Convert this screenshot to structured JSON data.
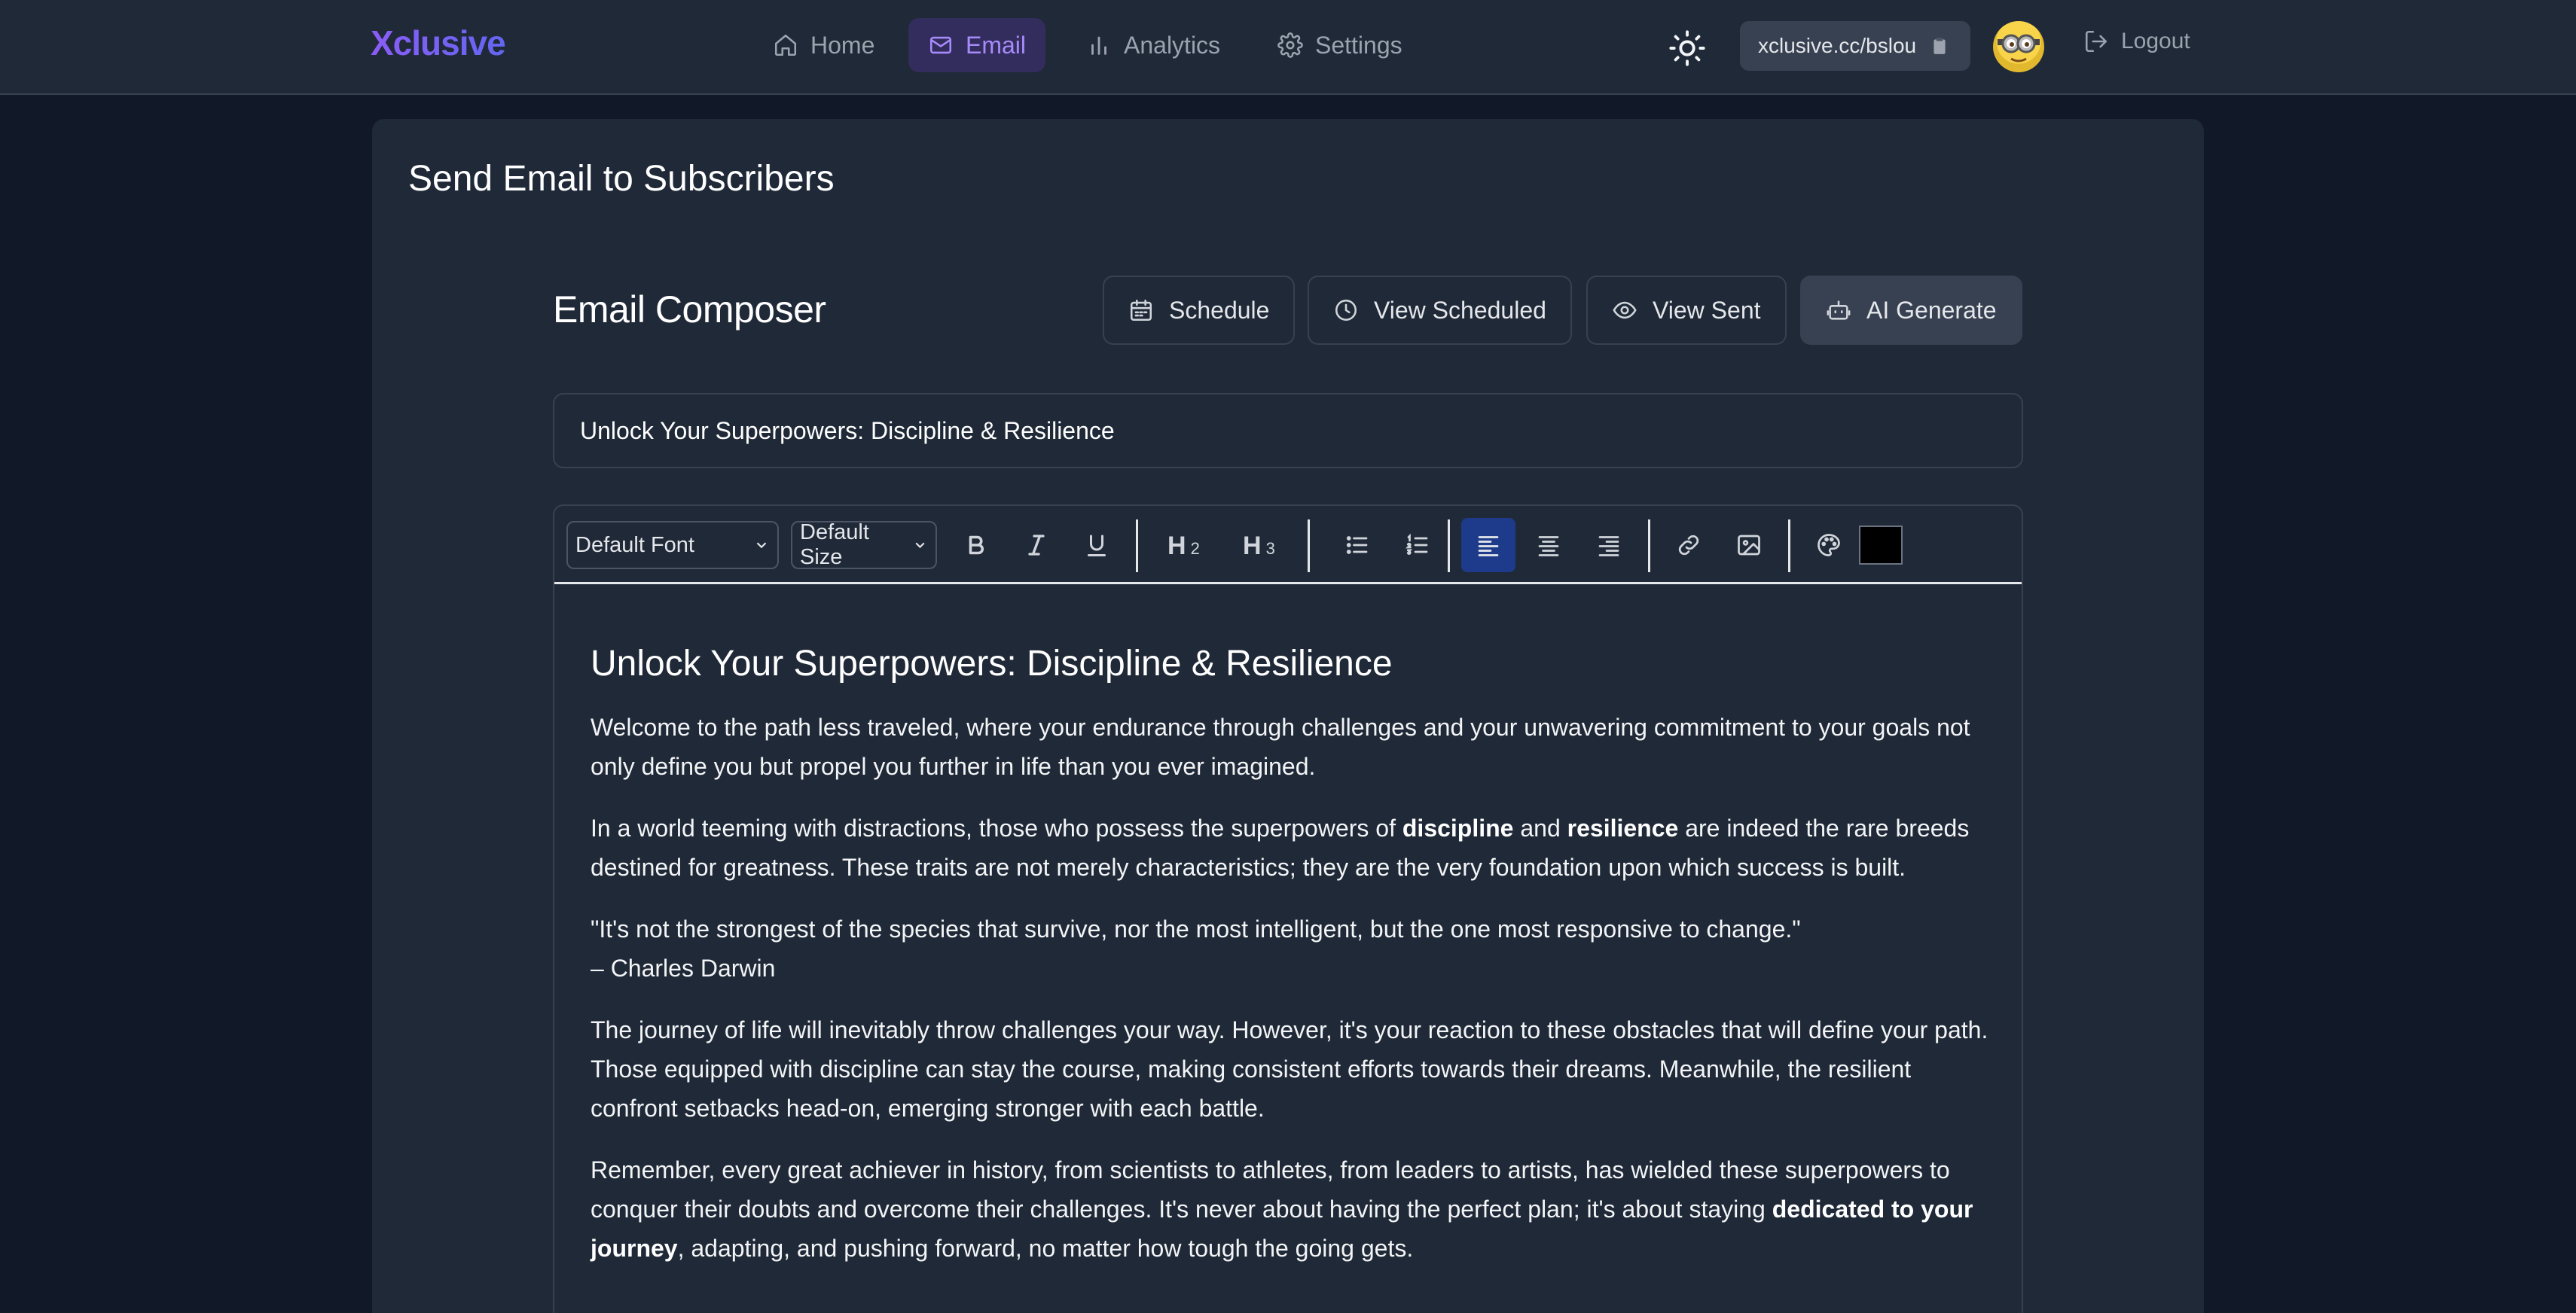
{
  "brand": "Xclusive",
  "nav": {
    "home": "Home",
    "email": "Email",
    "analytics": "Analytics",
    "settings": "Settings"
  },
  "header": {
    "url": "xclusive.cc/bslou",
    "logout": "Logout"
  },
  "page": {
    "title": "Send Email to Subscribers"
  },
  "composer": {
    "title": "Email Composer",
    "buttons": {
      "schedule": "Schedule",
      "view_scheduled": "View Scheduled",
      "view_sent": "View Sent",
      "ai_generate": "AI Generate"
    },
    "subject": "Unlock Your Superpowers: Discipline & Resilience"
  },
  "toolbar": {
    "font": "Default Font",
    "size": "Default Size",
    "h2": "2",
    "h3": "3",
    "color": "#000000"
  },
  "body": {
    "heading": "Unlock Your Superpowers: Discipline & Resilience",
    "p1": "Welcome to the path less traveled, where your endurance through challenges and your unwavering commitment to your goals not only define you but propel you further in life than you ever imagined.",
    "p2_a": "In a world teeming with distractions, those who possess the superpowers of ",
    "p2_b": "discipline",
    "p2_c": " and ",
    "p2_d": "resilience",
    "p2_e": " are indeed the rare breeds destined for greatness. These traits are not merely characteristics; they are the very foundation upon which success is built.",
    "quote": "\"It's not the strongest of the species that survive, nor the most intelligent, but the one most responsive to change.\"",
    "quote_author": "– Charles Darwin",
    "p3": "The journey of life will inevitably throw challenges your way. However, it's your reaction to these obstacles that will define your path. Those equipped with discipline can stay the course, making consistent efforts towards their dreams. Meanwhile, the resilient confront setbacks head-on, emerging stronger with each battle.",
    "p4_a": "Remember, every great achiever in history, from scientists to athletes, from leaders to artists, has wielded these superpowers to conquer their doubts and overcome their challenges. It's never about having the perfect plan; it's about staying ",
    "p4_b": "dedicated to your journey",
    "p4_c": ", adapting, and pushing forward, no matter how tough the going gets."
  }
}
